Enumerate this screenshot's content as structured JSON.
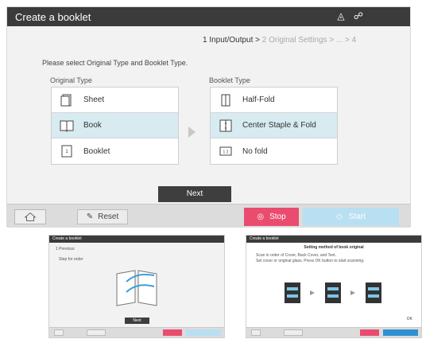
{
  "window": {
    "title": "Create a booklet"
  },
  "breadcrumb": {
    "active": "1 Input/Output",
    "separator1": ">",
    "step2": "2 Original Settings",
    "separator2": ">",
    "ellipsis": "...",
    "separator3": ">",
    "step4": "4"
  },
  "instruction": "Please select Original Type and Booklet Type.",
  "original_type": {
    "label": "Original Type",
    "items": [
      {
        "label": "Sheet",
        "selected": false,
        "icon": "sheet-icon"
      },
      {
        "label": "Book",
        "selected": true,
        "icon": "book-icon"
      },
      {
        "label": "Booklet",
        "selected": false,
        "icon": "booklet-icon"
      }
    ]
  },
  "booklet_type": {
    "label": "Booklet Type",
    "items": [
      {
        "label": "Half-Fold",
        "selected": false,
        "icon": "half-fold-icon"
      },
      {
        "label": "Center Staple & Fold",
        "selected": true,
        "icon": "center-staple-fold-icon"
      },
      {
        "label": "No fold",
        "selected": false,
        "icon": "no-fold-icon"
      }
    ]
  },
  "next_label": "Next",
  "bottom": {
    "reset_label": "Reset",
    "stop_label": "Stop",
    "start_label": "Start"
  },
  "colors": {
    "titlebar": "#3b3b3b",
    "selected": "#d7ebf1",
    "stop": "#e94c6e",
    "start": "#b9dff2"
  },
  "thumbnails": [
    {
      "title": "Create a booklet",
      "step": "1 Previous",
      "text": "Step for order",
      "next": "Next"
    },
    {
      "title": "Create a booklet",
      "heading": "Setting method of book original",
      "body1": "Scan in order of Cover, Back Cover, and Text.",
      "body2": "Set cover or original glass. Press OK button to start scanning.",
      "ok": "OK"
    }
  ]
}
